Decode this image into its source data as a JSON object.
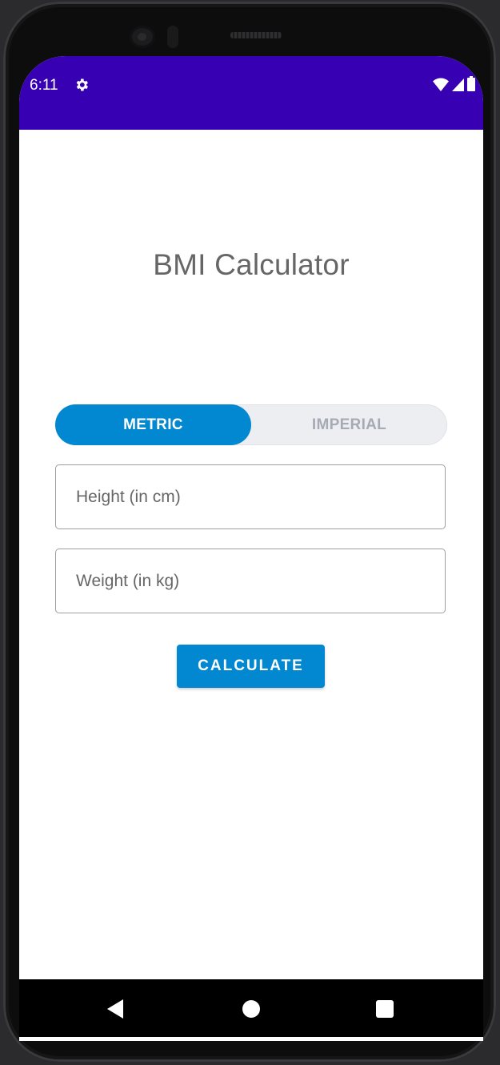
{
  "status_bar": {
    "time": "6:11",
    "background": "#3700b3",
    "icons": [
      "settings-icon",
      "wifi-icon",
      "signal-icon",
      "battery-icon"
    ]
  },
  "app": {
    "title": "BMI Calculator",
    "unit_toggle": {
      "metric_label": "METRIC",
      "imperial_label": "IMPERIAL",
      "selected": "METRIC"
    },
    "height_field": {
      "placeholder": "Height (in cm)",
      "value": ""
    },
    "weight_field": {
      "placeholder": "Weight (in kg)",
      "value": ""
    },
    "calculate_label": "CALCULATE",
    "accent_color": "#0288d1"
  },
  "nav_bar": {
    "icons": [
      "back-icon",
      "home-icon",
      "recents-icon"
    ]
  }
}
